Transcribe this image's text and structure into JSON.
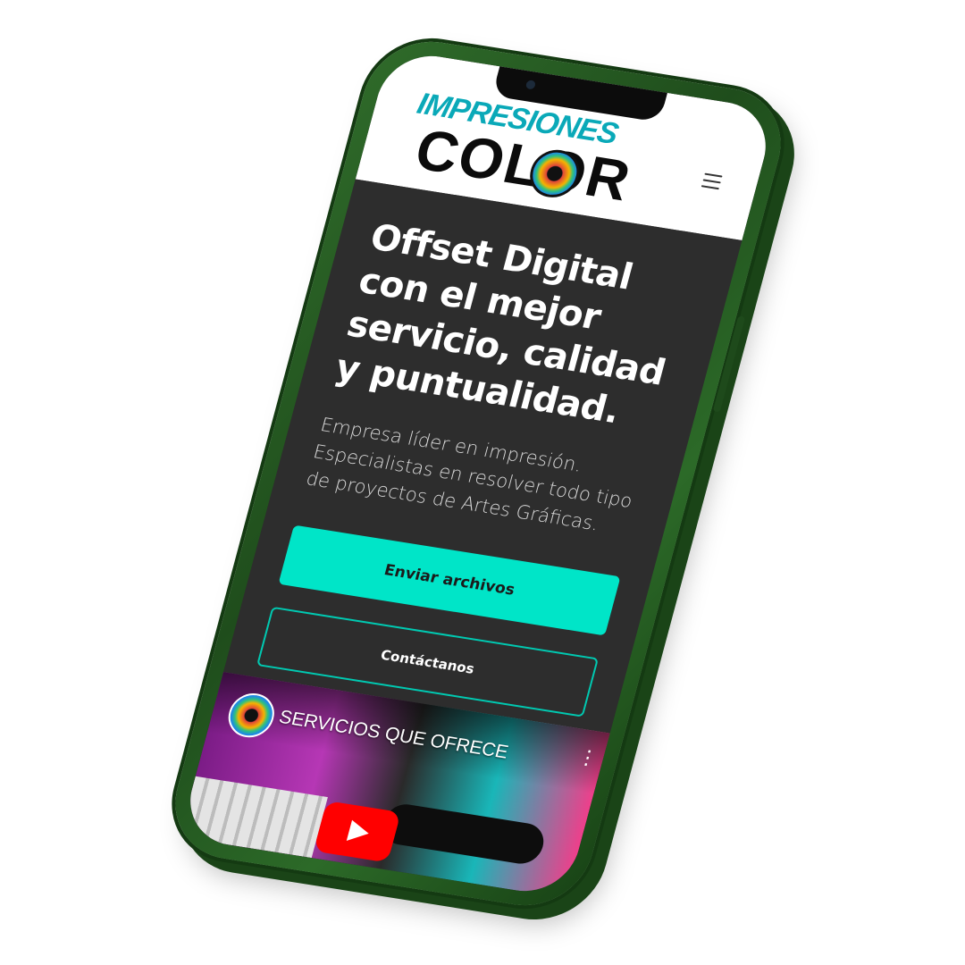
{
  "site": {
    "logo_top": "IMPRESIONES",
    "logo_bottom": "COLOR"
  },
  "nav": {
    "menu_icon": "hamburger-icon"
  },
  "hero": {
    "headline": "Offset Digital con el mejor servicio, calidad y puntualidad.",
    "description": "Empresa líder en impresión. Especialistas en resolver todo tipo de proyectos de Artes Gráficas.",
    "primary_button": "Enviar archivos",
    "secondary_button": "Contáctanos"
  },
  "video": {
    "title": "SERVICIOS QUE OFRECE",
    "more_icon": "vertical-dots-icon",
    "play_icon": "youtube-play-icon"
  },
  "colors": {
    "accent": "#00e5c8",
    "hero_bg": "#2d2d2d",
    "phone_body": "#2f6b2a"
  }
}
